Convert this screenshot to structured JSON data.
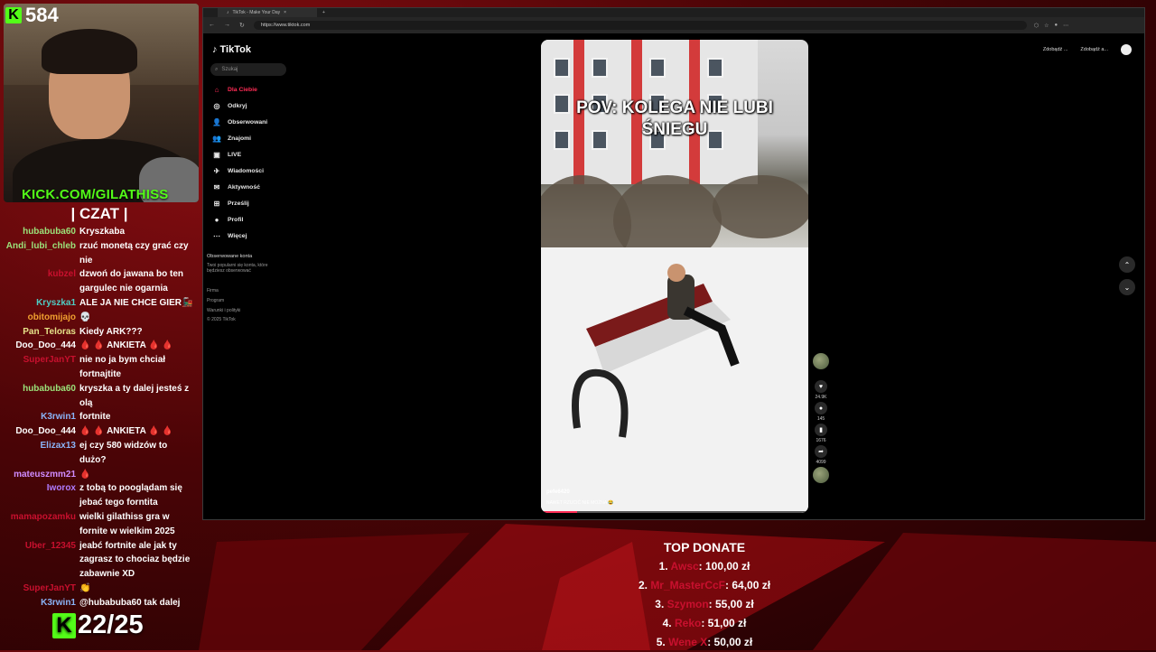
{
  "overlay": {
    "viewer_count": "584",
    "kick_url": "KICK.COM/GILATHISS",
    "chat_title": "| CZAT |",
    "counter": "22/25",
    "kick_green": "#53fc18"
  },
  "chat": [
    {
      "user": "hubabuba60",
      "color": "#9be27a",
      "text": "Kryszkaba"
    },
    {
      "user": "Andi_lubi_chleb",
      "color": "#9be27a",
      "text": "rzuć monetą czy grać czy nie"
    },
    {
      "user": "kubzel",
      "color": "#c8102e",
      "text": "dzwoń do jawana bo ten gargulec nie ogarnia"
    },
    {
      "user": "Kryszka1",
      "color": "#4ecdc4",
      "text": "ALE JA NIE CHCE GIER🚂"
    },
    {
      "user": "obitomijajo",
      "color": "#f0a030",
      "text": "💀"
    },
    {
      "user": "Pan_Teloras",
      "color": "#e6e38a",
      "text": "Kiedy ARK???"
    },
    {
      "user": "Doo_Doo_444",
      "color": "#ffffff",
      "text": "🩸 🩸 ANKIETA 🩸 🩸"
    },
    {
      "user": "SuperJanYT",
      "color": "#c8102e",
      "text": "nie no ja bym chciał fortnajtite"
    },
    {
      "user": "hubabuba60",
      "color": "#9be27a",
      "text": "kryszka a ty dalej jesteś z olą"
    },
    {
      "user": "K3rwin1",
      "color": "#8ab4f8",
      "text": "fortnite"
    },
    {
      "user": "Doo_Doo_444",
      "color": "#ffffff",
      "text": "🩸 🩸 ANKIETA 🩸 🩸"
    },
    {
      "user": "Elizax13",
      "color": "#8ab4f8",
      "text": "ej czy 580 widzów to dużo?"
    },
    {
      "user": "mateuszmm21",
      "color": "#d08cff",
      "text": "🩸"
    },
    {
      "user": "Iworox",
      "color": "#b07cff",
      "text": "z tobą to pooglądam się jebać tego forntita"
    },
    {
      "user": "mamapozamku",
      "color": "#c8102e",
      "text": "wielki gilathiss gra w fornite w wielkim 2025"
    },
    {
      "user": "Uber_12345",
      "color": "#c8102e",
      "text": "jeabć fortnite ale jak ty zagrasz to chociaz będzie zabawnie XD"
    },
    {
      "user": "SuperJanYT",
      "color": "#c8102e",
      "text": "👏"
    },
    {
      "user": "K3rwin1",
      "color": "#8ab4f8",
      "text": "@hubabuba60 tak dalej"
    }
  ],
  "browser": {
    "tab_title": "TikTok - Make Your Day",
    "url": "https://www.tiktok.com"
  },
  "tiktok": {
    "logo": "TikTok",
    "search_placeholder": "Szukaj",
    "nav": [
      {
        "label": "Dla Ciebie",
        "icon": "home-icon",
        "active": true
      },
      {
        "label": "Odkryj",
        "icon": "compass-icon"
      },
      {
        "label": "Obserwowani",
        "icon": "following-icon"
      },
      {
        "label": "Znajomi",
        "icon": "friends-icon"
      },
      {
        "label": "LIVE",
        "icon": "live-icon"
      },
      {
        "label": "Wiadomości",
        "icon": "messages-icon"
      },
      {
        "label": "Aktywność",
        "icon": "activity-icon"
      },
      {
        "label": "Prześlij",
        "icon": "upload-icon"
      },
      {
        "label": "Profil",
        "icon": "profile-icon"
      },
      {
        "label": "Więcej",
        "icon": "more-icon"
      }
    ],
    "followed_heading": "Obserwowane konta",
    "followed_note": "Twoi popularni się konta, które będziesz obserwować",
    "footer": [
      "Firma",
      "Program",
      "Warunki i polityki",
      "© 2025 TikTok"
    ],
    "top_right": [
      "Zdobądź ...",
      "Zdobądź a..."
    ],
    "video": {
      "caption": "POV: KOLEGA NIE LUBI ŚNIEGU",
      "username": "pefe6420",
      "description": "NAWET RZUCIĆ NIE MOŻNA 😂",
      "likes": "24.9K",
      "comments": "145",
      "saves": "1676",
      "shares": "4099"
    },
    "accent": "#fe2c55"
  },
  "donate": {
    "title": "TOP DONATE",
    "entries": [
      {
        "rank": "1.",
        "name": "Awsc",
        "amount": ": 100,00 zł"
      },
      {
        "rank": "2.",
        "name": "Mr_MasterCcF",
        "amount": ": 64,00 zł"
      },
      {
        "rank": "3.",
        "name": "Szymon",
        "amount": ": 55,00 zł"
      },
      {
        "rank": "4.",
        "name": "Reko",
        "amount": ": 51,00 zł"
      },
      {
        "rank": "5.",
        "name": "Wene X",
        "amount": ": 50,00 zł"
      }
    ]
  }
}
